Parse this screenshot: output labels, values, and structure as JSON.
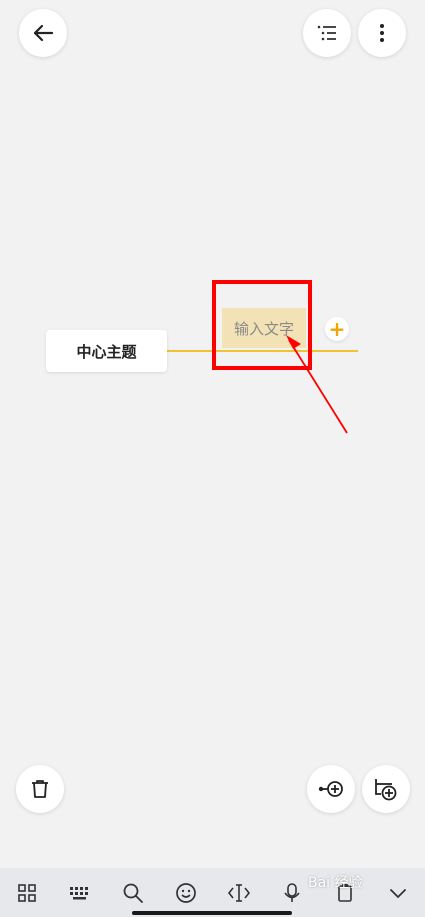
{
  "mindmap": {
    "central_topic": "中心主题",
    "child_topic_placeholder": "输入文字",
    "add_symbol": "+"
  },
  "colors": {
    "connector": "#f1c232",
    "child_topic_bg": "#f3e2b5",
    "annotation_red": "#ff0000",
    "accent_plus": "#f1a500"
  },
  "icons": {
    "top_left": "back-arrow-icon",
    "top_right": [
      "outline-list-icon",
      "more-vertical-icon"
    ],
    "bottom_left": "trash-icon",
    "bottom_right": [
      "add-sibling-node-icon",
      "add-child-node-icon"
    ]
  },
  "keyboard_toolbar": {
    "items": [
      "apps-grid-icon",
      "keyboard-icon",
      "search-icon",
      "emoji-icon",
      "cursor-icon",
      "microphone-icon",
      "clipboard-icon",
      "collapse-chevron-icon"
    ]
  },
  "watermark": "Bai 经验"
}
